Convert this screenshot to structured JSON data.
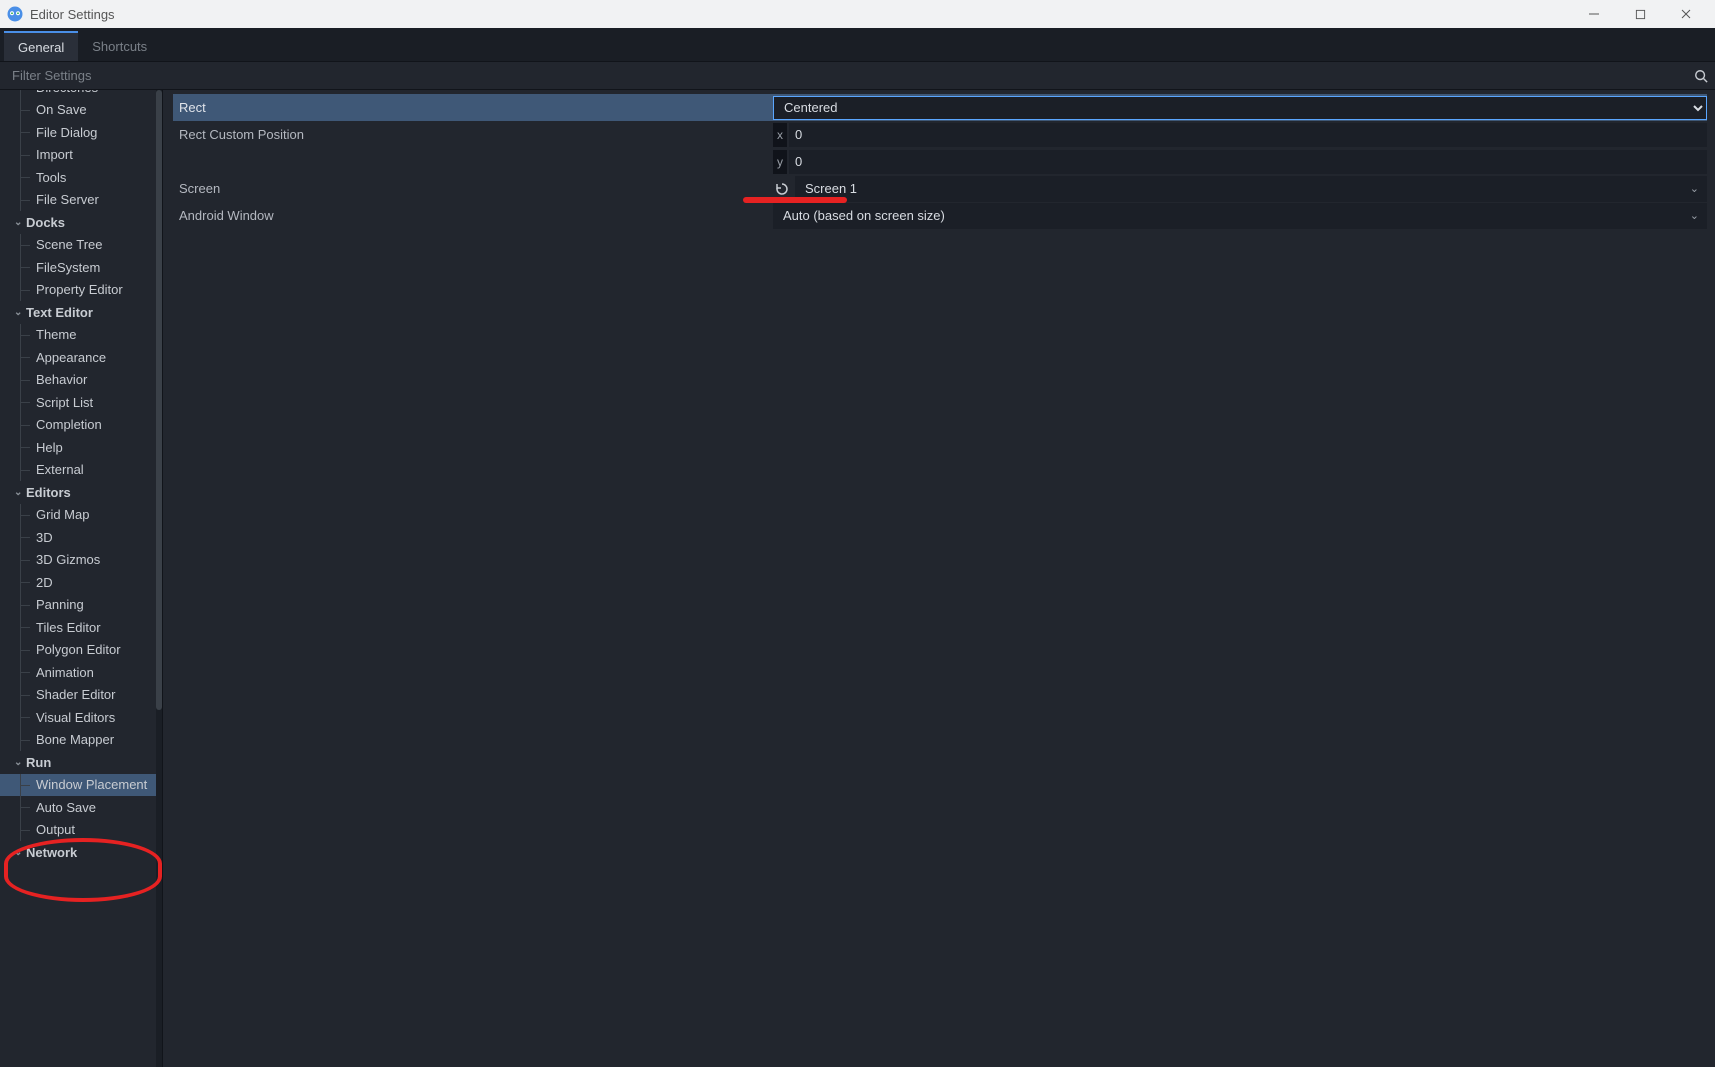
{
  "window": {
    "title": "Editor Settings"
  },
  "tabs": {
    "general": "General",
    "shortcuts": "Shortcuts"
  },
  "filter": {
    "placeholder": "Filter Settings"
  },
  "sidebar": {
    "items": [
      {
        "label": "Directories",
        "type": "item"
      },
      {
        "label": "On Save",
        "type": "item"
      },
      {
        "label": "File Dialog",
        "type": "item"
      },
      {
        "label": "Import",
        "type": "item"
      },
      {
        "label": "Tools",
        "type": "item"
      },
      {
        "label": "File Server",
        "type": "item"
      },
      {
        "label": "Docks",
        "type": "cat"
      },
      {
        "label": "Scene Tree",
        "type": "item"
      },
      {
        "label": "FileSystem",
        "type": "item"
      },
      {
        "label": "Property Editor",
        "type": "item"
      },
      {
        "label": "Text Editor",
        "type": "cat"
      },
      {
        "label": "Theme",
        "type": "item"
      },
      {
        "label": "Appearance",
        "type": "item"
      },
      {
        "label": "Behavior",
        "type": "item"
      },
      {
        "label": "Script List",
        "type": "item"
      },
      {
        "label": "Completion",
        "type": "item"
      },
      {
        "label": "Help",
        "type": "item"
      },
      {
        "label": "External",
        "type": "item"
      },
      {
        "label": "Editors",
        "type": "cat"
      },
      {
        "label": "Grid Map",
        "type": "item"
      },
      {
        "label": "3D",
        "type": "item"
      },
      {
        "label": "3D Gizmos",
        "type": "item"
      },
      {
        "label": "2D",
        "type": "item"
      },
      {
        "label": "Panning",
        "type": "item"
      },
      {
        "label": "Tiles Editor",
        "type": "item"
      },
      {
        "label": "Polygon Editor",
        "type": "item"
      },
      {
        "label": "Animation",
        "type": "item"
      },
      {
        "label": "Shader Editor",
        "type": "item"
      },
      {
        "label": "Visual Editors",
        "type": "item"
      },
      {
        "label": "Bone Mapper",
        "type": "item"
      },
      {
        "label": "Run",
        "type": "cat"
      },
      {
        "label": "Window Placement",
        "type": "item",
        "selected": true
      },
      {
        "label": "Auto Save",
        "type": "item"
      },
      {
        "label": "Output",
        "type": "item"
      },
      {
        "label": "Network",
        "type": "cat"
      }
    ]
  },
  "properties": {
    "rect": {
      "label": "Rect",
      "value": "Centered"
    },
    "rect_custom_position": {
      "label": "Rect Custom Position",
      "x_label": "x",
      "x_value": "0",
      "y_label": "y",
      "y_value": "0"
    },
    "screen": {
      "label": "Screen",
      "value": "Screen 1"
    },
    "android_window": {
      "label": "Android Window",
      "value": "Auto (based on screen size)"
    }
  }
}
